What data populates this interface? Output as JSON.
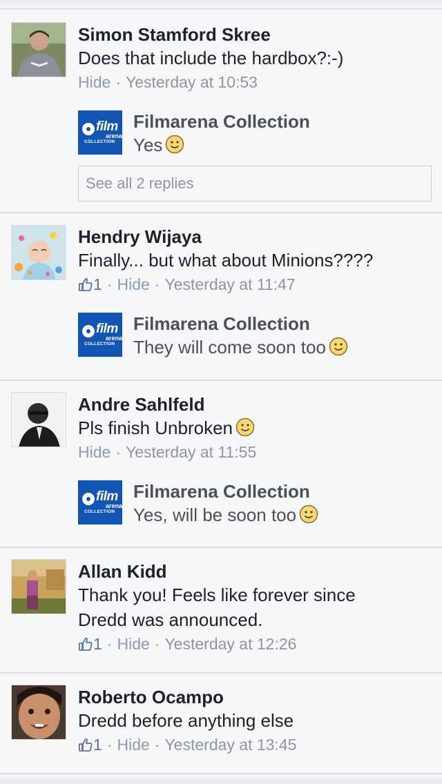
{
  "comments": [
    {
      "name": "Simon Stamford Skree",
      "text": "Does that include the hardbox?:-)",
      "hide": "Hide",
      "sep": "·",
      "time": "Yesterday at 10:53",
      "reply": {
        "name": "Filmarena Collection",
        "text": "Yes"
      },
      "see_all": "See all 2 replies"
    },
    {
      "name": "Hendry Wijaya",
      "text": "Finally... but what about Minions????",
      "likes": "1",
      "hide": "Hide",
      "sep": "·",
      "time": "Yesterday at 11:47",
      "reply": {
        "name": "Filmarena Collection",
        "text": "They will come soon too"
      }
    },
    {
      "name": "Andre Sahlfeld",
      "text": "Pls finish Unbroken",
      "hide": "Hide",
      "sep": "·",
      "time": "Yesterday at 11:55",
      "reply": {
        "name": "Filmarena Collection",
        "text": "Yes, will be soon too"
      }
    },
    {
      "name": "Allan Kidd",
      "text_line1": "Thank you! Feels like forever since",
      "text_line2": "Dredd was announced.",
      "likes": "1",
      "hide": "Hide",
      "sep": "·",
      "time": "Yesterday at 12:26"
    },
    {
      "name": "Roberto Ocampo",
      "text": "Dredd before anything else",
      "likes": "1",
      "hide": "Hide",
      "sep": "·",
      "time": "Yesterday at 13:45"
    }
  ],
  "logo": {
    "film": "film",
    "arena": "arena",
    "collection": "COLLECTION"
  },
  "colors": {
    "link": "#8a9ab8",
    "like": "#5a73a7",
    "page_logo": "#1155b4",
    "background": "#f6f7f9"
  },
  "icons": {
    "like": "thumbs-up-icon",
    "emoji_smile": "smile-emoji-icon"
  }
}
